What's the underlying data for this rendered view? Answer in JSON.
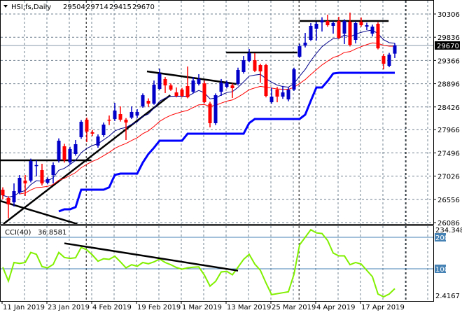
{
  "header": {
    "symbol": "HSI,fs,Daily",
    "open": "29504",
    "high": "29714",
    "low": "29415",
    "close": "29670"
  },
  "cci_header": {
    "name": "CCI(40)",
    "value": "36.8581"
  },
  "colors": {
    "bull": "#0000c8",
    "bear": "#ff0000",
    "ma_fast": "#00008b",
    "ma_slow": "#ff0000",
    "step": "#0000ff",
    "cci": "#80f000",
    "level": "#4682b4",
    "grid": "#708090",
    "trend": "#000000"
  },
  "chart_data": [
    {
      "type": "candlestick",
      "title": "HSI,fs,Daily",
      "ylim": [
        26086,
        30306
      ],
      "y_ticks": [
        "30306",
        "29836",
        "29366",
        "28896",
        "28426",
        "27966",
        "27496",
        "27026",
        "26556",
        "26086"
      ],
      "bid_price": "29670",
      "x_ticks": [
        {
          "index": 0,
          "label": "11 Jan 2019"
        },
        {
          "index": 8,
          "label": "23 Jan 2019"
        },
        {
          "index": 16,
          "label": "4 Feb 2019"
        },
        {
          "index": 24,
          "label": "19 Feb 2019"
        },
        {
          "index": 32,
          "label": "1 Mar 2019"
        },
        {
          "index": 40,
          "label": "13 Mar 2019"
        },
        {
          "index": 48,
          "label": "25 Mar 2019"
        },
        {
          "index": 56,
          "label": "4 Apr 2019"
        },
        {
          "index": 64,
          "label": "17 Apr 2019"
        }
      ],
      "period_separators": [
        14.9,
        52.9,
        72
      ],
      "candles": [
        [
          26752,
          26800,
          26560,
          26638
        ],
        [
          26582,
          26620,
          26171,
          26454
        ],
        [
          26497,
          26879,
          26412,
          26723
        ],
        [
          26695,
          27049,
          26660,
          26992
        ],
        [
          26936,
          27049,
          26624,
          26879
        ],
        [
          26936,
          27380,
          26900,
          27332
        ],
        [
          27247,
          27346,
          27021,
          27250
        ],
        [
          27148,
          27276,
          26837,
          26879
        ],
        [
          26893,
          27000,
          26860,
          26964
        ],
        [
          27049,
          27304,
          26879,
          27247
        ],
        [
          27346,
          27790,
          27300,
          27743
        ],
        [
          27630,
          27680,
          27300,
          27346
        ],
        [
          27304,
          27620,
          27260,
          27573
        ],
        [
          27474,
          27757,
          27440,
          27672
        ],
        [
          27814,
          28160,
          27780,
          28125
        ],
        [
          28168,
          28210,
          27715,
          27927
        ],
        [
          27913,
          27960,
          27840,
          27885
        ],
        [
          27644,
          27870,
          27600,
          27828
        ],
        [
          27856,
          28111,
          27820,
          28069
        ],
        [
          28168,
          28253,
          28060,
          28153
        ],
        [
          28182,
          28508,
          28140,
          28352
        ],
        [
          28281,
          28437,
          28130,
          28168
        ],
        [
          28168,
          28200,
          27757,
          28111
        ],
        [
          28210,
          28437,
          28180,
          28324
        ],
        [
          28253,
          28380,
          28200,
          28324
        ],
        [
          28437,
          28700,
          28410,
          28663
        ],
        [
          28550,
          28600,
          28430,
          28493
        ],
        [
          28493,
          28960,
          28470,
          28876
        ],
        [
          28791,
          29201,
          28770,
          29102
        ],
        [
          28989,
          29030,
          28706,
          28862
        ],
        [
          28862,
          28900,
          28750,
          28777
        ],
        [
          28720,
          28820,
          28620,
          28649
        ],
        [
          28777,
          28810,
          28620,
          28649
        ],
        [
          28847,
          29244,
          28600,
          28621
        ],
        [
          28734,
          29031,
          28700,
          28961
        ],
        [
          28890,
          29088,
          28860,
          28989
        ],
        [
          28904,
          28960,
          28500,
          28522
        ],
        [
          28493,
          28530,
          28012,
          28097
        ],
        [
          28097,
          28700,
          28060,
          28663
        ],
        [
          28734,
          28990,
          28649,
          28918
        ],
        [
          28833,
          28960,
          28800,
          28918
        ],
        [
          28862,
          28900,
          28607,
          28805
        ],
        [
          28890,
          29220,
          28860,
          29173
        ],
        [
          29131,
          29456,
          29100,
          29371
        ],
        [
          29357,
          29598,
          29330,
          29513
        ],
        [
          29371,
          29513,
          29130,
          29159
        ],
        [
          29272,
          29300,
          28918,
          29145
        ],
        [
          29272,
          29300,
          28620,
          28649
        ],
        [
          28522,
          28819,
          28490,
          28635
        ],
        [
          28777,
          28830,
          28520,
          28635
        ],
        [
          28635,
          28850,
          28590,
          28720
        ],
        [
          28578,
          28820,
          28540,
          28777
        ],
        [
          28777,
          29220,
          28750,
          29187
        ],
        [
          29442,
          29700,
          29420,
          29654
        ],
        [
          29669,
          29923,
          29630,
          29726
        ],
        [
          29782,
          30122,
          29760,
          30065
        ],
        [
          30009,
          30150,
          29768,
          30108
        ],
        [
          30136,
          30240,
          29952,
          30178
        ],
        [
          30164,
          30292,
          30050,
          30079
        ],
        [
          30065,
          30160,
          29909,
          30122
        ],
        [
          30164,
          30250,
          29800,
          29824
        ],
        [
          29909,
          30200,
          29697,
          30164
        ],
        [
          30150,
          30334,
          29650,
          29683
        ],
        [
          29782,
          30160,
          29711,
          30122
        ],
        [
          30150,
          30235,
          30050,
          30079
        ],
        [
          30051,
          30130,
          29980,
          30079
        ],
        [
          29909,
          30090,
          29853,
          30051
        ],
        [
          30108,
          30140,
          29590,
          29612
        ],
        [
          29456,
          29500,
          29187,
          29300
        ],
        [
          29258,
          29520,
          29230,
          29484
        ],
        [
          29504,
          29714,
          29415,
          29670
        ]
      ],
      "ma_fast_period": 9,
      "ma_slow_period": 20,
      "step_line_start_index": 10,
      "step_line": [
        26313,
        26355,
        26355,
        26400,
        26752,
        26752,
        26752,
        26752,
        26752,
        26800,
        27050,
        27077,
        27077,
        27077,
        27077,
        27300,
        27474,
        27600,
        27743,
        27743,
        27743,
        27743,
        27743,
        27884,
        27884,
        27884,
        27884,
        27884,
        27884,
        27884,
        27884,
        27884,
        27884,
        27884,
        28100,
        28182,
        28182,
        28182,
        28182,
        28182,
        28182,
        28182,
        28182,
        28182,
        28270,
        28550,
        28819,
        28819,
        28950,
        29102,
        29116,
        29116,
        29116,
        29116,
        29116,
        29116,
        29116,
        29116,
        29116,
        29116,
        29116
      ],
      "trendlines": [
        {
          "from": [
            -0.5,
            27346
          ],
          "to": [
            15.8,
            27346
          ]
        },
        {
          "from": [
            0.1,
            26058
          ],
          "to": [
            29.9,
            28663
          ]
        },
        {
          "from": [
            -0.5,
            26525
          ],
          "to": [
            13.3,
            26058
          ]
        },
        {
          "from": [
            25.75,
            29145
          ],
          "to": [
            41.75,
            28890
          ]
        },
        {
          "from": [
            39.9,
            29527
          ],
          "to": [
            52.6,
            29527
          ]
        },
        {
          "from": [
            53.0,
            30164
          ],
          "to": [
            68.9,
            30164
          ]
        }
      ]
    },
    {
      "type": "line",
      "title": "CCI(40) 36.8581",
      "ylim": [
        2.4167,
        234.3487
      ],
      "y_labels": [
        "234.3487",
        "200",
        "100",
        "2.4167"
      ],
      "levels": [
        200,
        100
      ],
      "values": [
        105,
        61,
        120,
        117,
        120,
        152,
        146,
        107,
        103,
        114,
        152,
        136,
        133,
        135,
        168,
        160,
        144,
        124,
        132,
        130,
        140,
        122,
        103,
        113,
        108,
        120,
        116,
        122,
        131,
        120,
        113,
        104,
        99,
        103,
        105,
        106,
        80,
        45,
        60,
        90,
        92,
        81,
        105,
        130,
        146,
        115,
        95,
        55,
        18,
        21,
        24,
        27,
        83,
        176,
        200,
        224,
        214,
        212,
        190,
        150,
        141,
        141,
        113,
        120,
        115,
        95,
        75,
        20,
        11,
        20,
        36.86
      ],
      "trendline": {
        "from": [
          11,
          181
        ],
        "to": [
          42,
          94
        ]
      }
    }
  ]
}
